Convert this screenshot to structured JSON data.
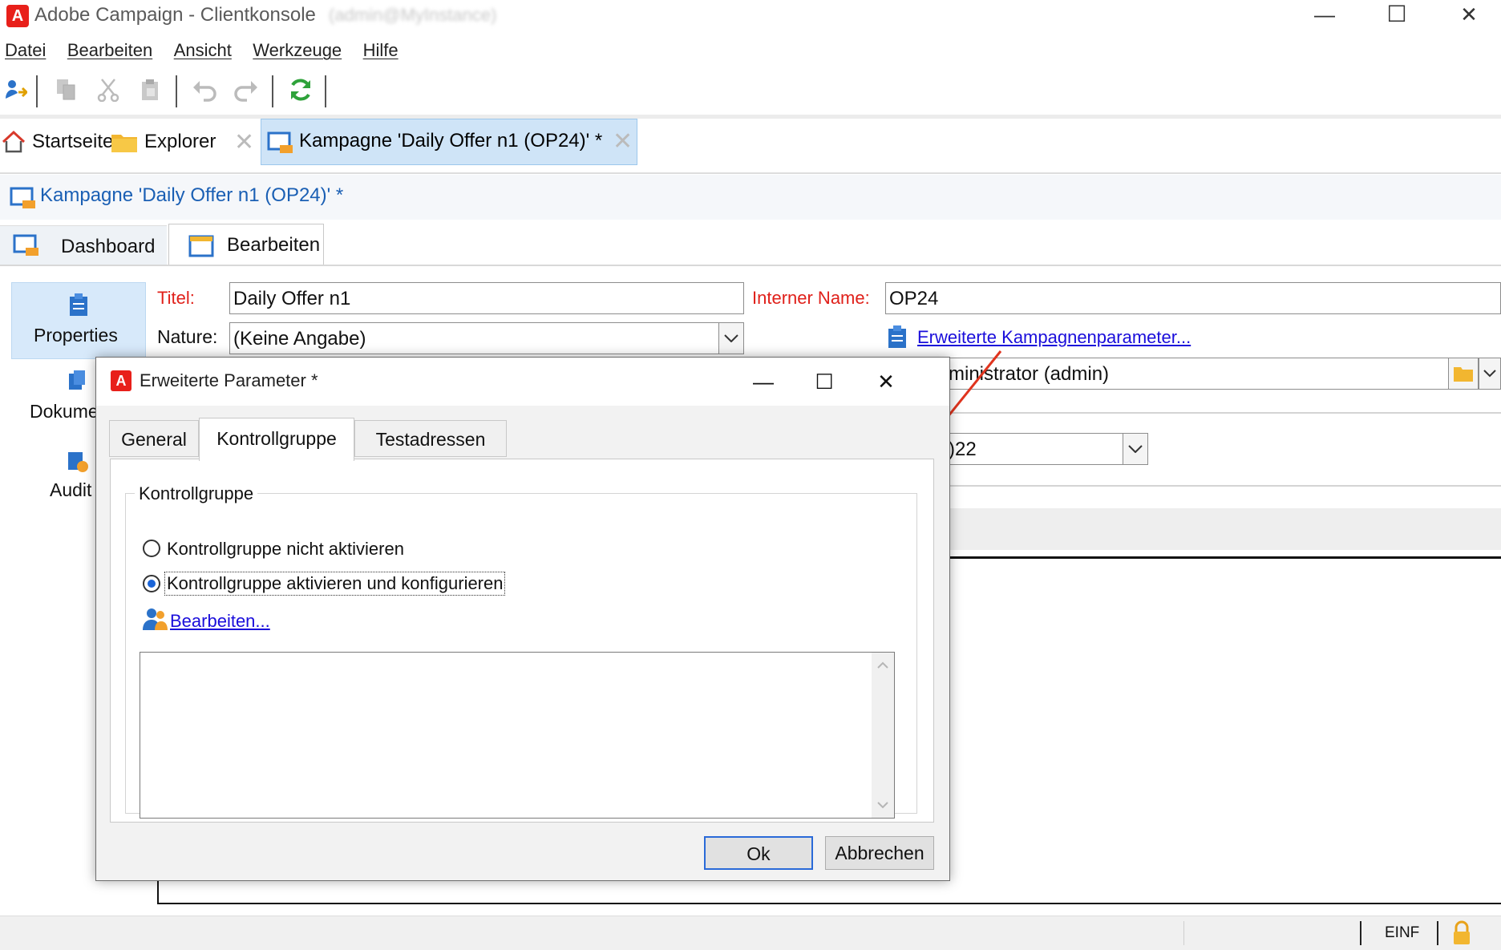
{
  "app": {
    "logo_letter": "A",
    "title": "Adobe Campaign - Clientkonsole",
    "user_blurred": "(admin@MyInstance)",
    "window_buttons": {
      "minimize": "—",
      "maximize": "☐",
      "close": "✕"
    }
  },
  "menu": [
    "Datei",
    "Bearbeiten",
    "Ansicht",
    "Werkzeuge",
    "Hilfe"
  ],
  "toolbar": {
    "icons": [
      "new-user-icon",
      "copy-icon",
      "cut-icon",
      "paste-icon",
      "undo-icon",
      "redo-icon",
      "refresh-icon"
    ]
  },
  "tabs": {
    "home": "Startseite",
    "explorer": "Explorer",
    "document": "Kampagne 'Daily Offer n1 (OP24)' *"
  },
  "campaign": {
    "title": "Kampagne 'Daily Offer n1 (OP24)' *",
    "subtabs": {
      "dashboard": "Dashboard",
      "edit": "Bearbeiten"
    }
  },
  "nav": {
    "properties": "Properties",
    "documents": "Dokume",
    "audit": "Audit"
  },
  "form": {
    "title_label": "Titel:",
    "title_value": "Daily Offer n1",
    "internal_name_label": "Interner Name:",
    "internal_name_value": "OP24",
    "nature_label": "Nature:",
    "nature_value": "(Keine Angabe)",
    "advanced_link": "Erweiterte Kampagnenparameter...",
    "operator_value": "ministrator (admin)",
    "date_value": ")22"
  },
  "dialog": {
    "title": "Erweiterte Parameter *",
    "tabs": [
      "General",
      "Kontrollgruppe",
      "Testadressen"
    ],
    "active_tab": "Kontrollgruppe",
    "group_legend": "Kontrollgruppe",
    "option_off": "Kontrollgruppe nicht aktivieren",
    "option_on": "Kontrollgruppe aktivieren und konfigurieren",
    "selected_option": "option_on",
    "edit_link": "Bearbeiten...",
    "ok": "Ok",
    "cancel": "Abbrechen"
  },
  "status": {
    "mode": "EINF"
  },
  "colors": {
    "accent_red": "#e8201a",
    "link_blue": "#1a0ddb",
    "arrow": "#e0341e",
    "tab_selected": "#cfe4f7"
  }
}
